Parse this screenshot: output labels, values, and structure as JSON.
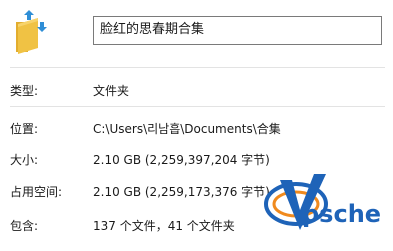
{
  "header": {
    "name_value": "脸红的思春期合集"
  },
  "properties": [
    {
      "label": "类型:",
      "value": "文件夹"
    },
    {
      "label": "位置:",
      "value": "C:\\Users\\리남흡\\Documents\\合集"
    },
    {
      "label": "大小:",
      "value": "2.10 GB (2,259,397,204 字节)"
    },
    {
      "label": "占用空间:",
      "value": "2.10 GB (2,259,173,376 字节)"
    },
    {
      "label": "包含:",
      "value": "137 个文件，41 个文件夹"
    }
  ],
  "watermark": {
    "brand_text": "psche"
  },
  "colors": {
    "folder_yellow": "#f0c244",
    "arrow_blue": "#2f8ed6",
    "watermark_blue": "#1e63b8",
    "watermark_orange": "#f08a1e",
    "divider": "#e3e3e3"
  },
  "icons": {
    "folder": "folder-icon",
    "shortcut": "shortcut-arrows-icon"
  }
}
